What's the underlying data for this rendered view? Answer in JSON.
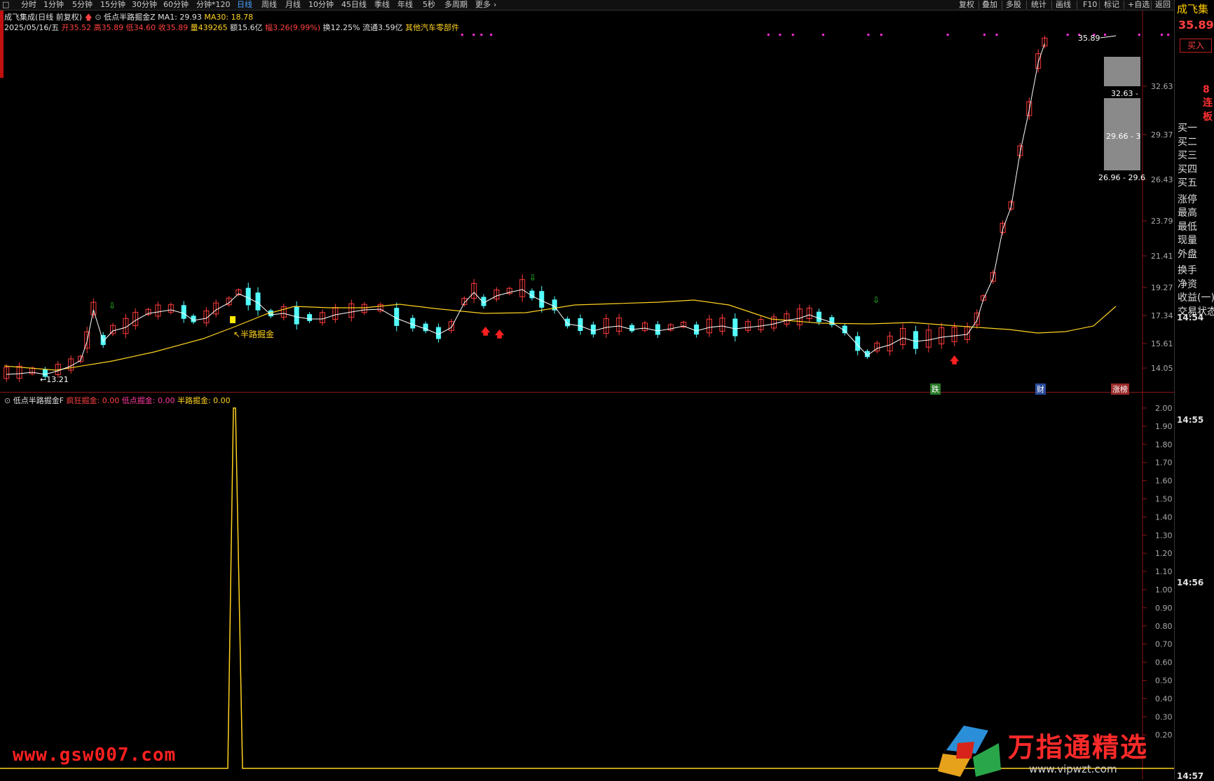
{
  "toolbar": {
    "items": [
      "分时",
      "1分钟",
      "5分钟",
      "15分钟",
      "30分钟",
      "60分钟",
      "分钟*120",
      "日线",
      "周线",
      "月线",
      "10分钟",
      "45日线",
      "季线",
      "年线",
      "5秒",
      "多周期",
      "更多"
    ],
    "active": "日线",
    "right_items": [
      "复权",
      "叠加",
      "多股",
      "统计",
      "画线",
      "F10",
      "标记",
      "+自选",
      "返回"
    ]
  },
  "info": {
    "stock_title": "成飞集成(日线 前复权)",
    "indicator_name": "低点半路掘金Z",
    "ma1_label": "MA1: 29.93",
    "ma30_label": "MA30: 18.78",
    "date": "2025/05/16/五",
    "open": "开35.52",
    "high": "高35.89",
    "low": "低34.60",
    "close": "收35.89",
    "volume": "量439265",
    "amount": "额15.6亿",
    "change": "幅3.26(9.99%)",
    "turnover": "换12.25%",
    "float": "流通3.59亿",
    "sector": "其他汽车零部件"
  },
  "price_axis": [
    "32.63",
    "29.37",
    "26.43",
    "23.79",
    "21.41",
    "19.27",
    "17.34",
    "15.61",
    "14.05"
  ],
  "annotations": {
    "high_mark": "35.89",
    "low_mark": "13.21",
    "signal_label": "半路掘金",
    "box1": "32.63 -",
    "box2": "29.66 - 3",
    "box3": "26.96 - 29.6"
  },
  "badges": {
    "die": "跌",
    "cai": "财",
    "zhang": "涨榜"
  },
  "sub": {
    "title": "低点半路掘金F",
    "crazy": "疯狂掘金: 0.00",
    "low": "低点掘金: 0.00",
    "half": "半路掘金: 0.00",
    "axis": [
      "2.00",
      "1.90",
      "1.80",
      "1.70",
      "1.60",
      "1.50",
      "1.40",
      "1.30",
      "1.20",
      "1.10",
      "1.00",
      "0.90",
      "0.80",
      "0.70",
      "0.60",
      "0.50",
      "0.40",
      "0.30",
      "0.20"
    ]
  },
  "right_panel": {
    "stock_name": "成飞集",
    "price": "35.89",
    "buy": "买入",
    "limit_up": "8连板",
    "levels": [
      "买一",
      "买二",
      "买三",
      "买四",
      "买五",
      "涨停",
      "最高",
      "最低",
      "现量",
      "外盘",
      "换手",
      "净资",
      "收益(一)",
      "交易状态"
    ],
    "times": [
      "14:54",
      "14:55",
      "14:56",
      "14:57"
    ]
  },
  "watermark": {
    "left": "www.gsw007.com",
    "brand": "万指通精选",
    "url": "www.vipwzt.com"
  },
  "colors": {
    "up": "#ff3b3b",
    "down": "#54ffff",
    "ma1": "#ffffff",
    "ma30": "#ffd21f",
    "sub_line": "#ffd21f"
  }
}
